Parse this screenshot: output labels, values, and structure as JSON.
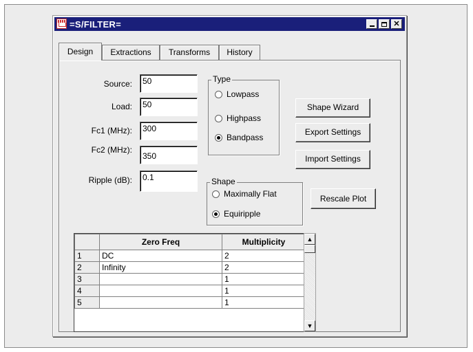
{
  "window": {
    "title": "=S/FILTER="
  },
  "tabs": [
    {
      "label": "Design",
      "active": true
    },
    {
      "label": "Extractions",
      "active": false
    },
    {
      "label": "Transforms",
      "active": false
    },
    {
      "label": "History",
      "active": false
    }
  ],
  "fields": {
    "source": {
      "label": "Source:",
      "value": "50"
    },
    "load": {
      "label": "Load:",
      "value": "50"
    },
    "fc1": {
      "label": "Fc1 (MHz):",
      "value": "300"
    },
    "fc2": {
      "label": "Fc2 (MHz):",
      "value": "350"
    },
    "ripple": {
      "label": "Ripple (dB):",
      "value": "0.1"
    }
  },
  "type_group": {
    "legend": "Type",
    "options": [
      "Lowpass",
      "Highpass",
      "Bandpass"
    ],
    "selected": "Bandpass"
  },
  "shape_group": {
    "legend": "Shape",
    "options": [
      "Maximally Flat",
      "Equiripple"
    ],
    "selected": "Equiripple"
  },
  "buttons": {
    "shape_wizard": "Shape Wizard",
    "export_settings": "Export Settings",
    "import_settings": "Import Settings",
    "rescale_plot": "Rescale Plot"
  },
  "zero_table": {
    "columns": [
      "Zero Freq",
      "Multiplicity"
    ],
    "rows": [
      {
        "num": "1",
        "freq": "DC",
        "mult": "2"
      },
      {
        "num": "2",
        "freq": "Infinity",
        "mult": "2"
      },
      {
        "num": "3",
        "freq": "",
        "mult": "1"
      },
      {
        "num": "4",
        "freq": "",
        "mult": "1"
      },
      {
        "num": "5",
        "freq": "",
        "mult": "1"
      }
    ]
  }
}
